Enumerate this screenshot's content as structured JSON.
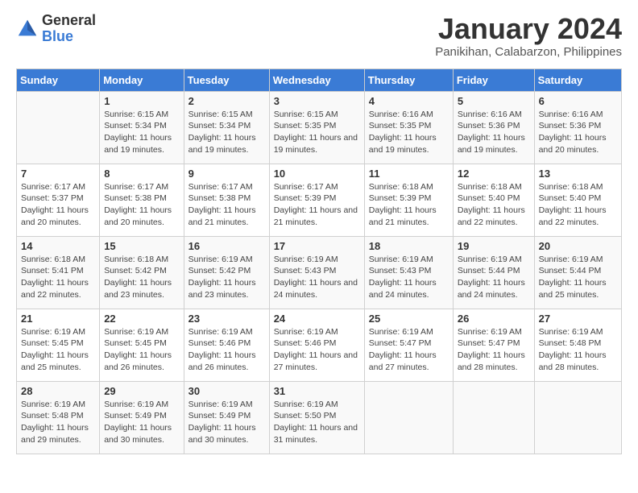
{
  "logo": {
    "general": "General",
    "blue": "Blue"
  },
  "title": "January 2024",
  "location": "Panikihan, Calabarzon, Philippines",
  "days_header": [
    "Sunday",
    "Monday",
    "Tuesday",
    "Wednesday",
    "Thursday",
    "Friday",
    "Saturday"
  ],
  "weeks": [
    [
      {
        "day": "",
        "sunrise": "",
        "sunset": "",
        "daylight": ""
      },
      {
        "day": "1",
        "sunrise": "Sunrise: 6:15 AM",
        "sunset": "Sunset: 5:34 PM",
        "daylight": "Daylight: 11 hours and 19 minutes."
      },
      {
        "day": "2",
        "sunrise": "Sunrise: 6:15 AM",
        "sunset": "Sunset: 5:34 PM",
        "daylight": "Daylight: 11 hours and 19 minutes."
      },
      {
        "day": "3",
        "sunrise": "Sunrise: 6:15 AM",
        "sunset": "Sunset: 5:35 PM",
        "daylight": "Daylight: 11 hours and 19 minutes."
      },
      {
        "day": "4",
        "sunrise": "Sunrise: 6:16 AM",
        "sunset": "Sunset: 5:35 PM",
        "daylight": "Daylight: 11 hours and 19 minutes."
      },
      {
        "day": "5",
        "sunrise": "Sunrise: 6:16 AM",
        "sunset": "Sunset: 5:36 PM",
        "daylight": "Daylight: 11 hours and 19 minutes."
      },
      {
        "day": "6",
        "sunrise": "Sunrise: 6:16 AM",
        "sunset": "Sunset: 5:36 PM",
        "daylight": "Daylight: 11 hours and 20 minutes."
      }
    ],
    [
      {
        "day": "7",
        "sunrise": "Sunrise: 6:17 AM",
        "sunset": "Sunset: 5:37 PM",
        "daylight": "Daylight: 11 hours and 20 minutes."
      },
      {
        "day": "8",
        "sunrise": "Sunrise: 6:17 AM",
        "sunset": "Sunset: 5:38 PM",
        "daylight": "Daylight: 11 hours and 20 minutes."
      },
      {
        "day": "9",
        "sunrise": "Sunrise: 6:17 AM",
        "sunset": "Sunset: 5:38 PM",
        "daylight": "Daylight: 11 hours and 21 minutes."
      },
      {
        "day": "10",
        "sunrise": "Sunrise: 6:17 AM",
        "sunset": "Sunset: 5:39 PM",
        "daylight": "Daylight: 11 hours and 21 minutes."
      },
      {
        "day": "11",
        "sunrise": "Sunrise: 6:18 AM",
        "sunset": "Sunset: 5:39 PM",
        "daylight": "Daylight: 11 hours and 21 minutes."
      },
      {
        "day": "12",
        "sunrise": "Sunrise: 6:18 AM",
        "sunset": "Sunset: 5:40 PM",
        "daylight": "Daylight: 11 hours and 22 minutes."
      },
      {
        "day": "13",
        "sunrise": "Sunrise: 6:18 AM",
        "sunset": "Sunset: 5:40 PM",
        "daylight": "Daylight: 11 hours and 22 minutes."
      }
    ],
    [
      {
        "day": "14",
        "sunrise": "Sunrise: 6:18 AM",
        "sunset": "Sunset: 5:41 PM",
        "daylight": "Daylight: 11 hours and 22 minutes."
      },
      {
        "day": "15",
        "sunrise": "Sunrise: 6:18 AM",
        "sunset": "Sunset: 5:42 PM",
        "daylight": "Daylight: 11 hours and 23 minutes."
      },
      {
        "day": "16",
        "sunrise": "Sunrise: 6:19 AM",
        "sunset": "Sunset: 5:42 PM",
        "daylight": "Daylight: 11 hours and 23 minutes."
      },
      {
        "day": "17",
        "sunrise": "Sunrise: 6:19 AM",
        "sunset": "Sunset: 5:43 PM",
        "daylight": "Daylight: 11 hours and 24 minutes."
      },
      {
        "day": "18",
        "sunrise": "Sunrise: 6:19 AM",
        "sunset": "Sunset: 5:43 PM",
        "daylight": "Daylight: 11 hours and 24 minutes."
      },
      {
        "day": "19",
        "sunrise": "Sunrise: 6:19 AM",
        "sunset": "Sunset: 5:44 PM",
        "daylight": "Daylight: 11 hours and 24 minutes."
      },
      {
        "day": "20",
        "sunrise": "Sunrise: 6:19 AM",
        "sunset": "Sunset: 5:44 PM",
        "daylight": "Daylight: 11 hours and 25 minutes."
      }
    ],
    [
      {
        "day": "21",
        "sunrise": "Sunrise: 6:19 AM",
        "sunset": "Sunset: 5:45 PM",
        "daylight": "Daylight: 11 hours and 25 minutes."
      },
      {
        "day": "22",
        "sunrise": "Sunrise: 6:19 AM",
        "sunset": "Sunset: 5:45 PM",
        "daylight": "Daylight: 11 hours and 26 minutes."
      },
      {
        "day": "23",
        "sunrise": "Sunrise: 6:19 AM",
        "sunset": "Sunset: 5:46 PM",
        "daylight": "Daylight: 11 hours and 26 minutes."
      },
      {
        "day": "24",
        "sunrise": "Sunrise: 6:19 AM",
        "sunset": "Sunset: 5:46 PM",
        "daylight": "Daylight: 11 hours and 27 minutes."
      },
      {
        "day": "25",
        "sunrise": "Sunrise: 6:19 AM",
        "sunset": "Sunset: 5:47 PM",
        "daylight": "Daylight: 11 hours and 27 minutes."
      },
      {
        "day": "26",
        "sunrise": "Sunrise: 6:19 AM",
        "sunset": "Sunset: 5:47 PM",
        "daylight": "Daylight: 11 hours and 28 minutes."
      },
      {
        "day": "27",
        "sunrise": "Sunrise: 6:19 AM",
        "sunset": "Sunset: 5:48 PM",
        "daylight": "Daylight: 11 hours and 28 minutes."
      }
    ],
    [
      {
        "day": "28",
        "sunrise": "Sunrise: 6:19 AM",
        "sunset": "Sunset: 5:48 PM",
        "daylight": "Daylight: 11 hours and 29 minutes."
      },
      {
        "day": "29",
        "sunrise": "Sunrise: 6:19 AM",
        "sunset": "Sunset: 5:49 PM",
        "daylight": "Daylight: 11 hours and 30 minutes."
      },
      {
        "day": "30",
        "sunrise": "Sunrise: 6:19 AM",
        "sunset": "Sunset: 5:49 PM",
        "daylight": "Daylight: 11 hours and 30 minutes."
      },
      {
        "day": "31",
        "sunrise": "Sunrise: 6:19 AM",
        "sunset": "Sunset: 5:50 PM",
        "daylight": "Daylight: 11 hours and 31 minutes."
      },
      {
        "day": "",
        "sunrise": "",
        "sunset": "",
        "daylight": ""
      },
      {
        "day": "",
        "sunrise": "",
        "sunset": "",
        "daylight": ""
      },
      {
        "day": "",
        "sunrise": "",
        "sunset": "",
        "daylight": ""
      }
    ]
  ]
}
